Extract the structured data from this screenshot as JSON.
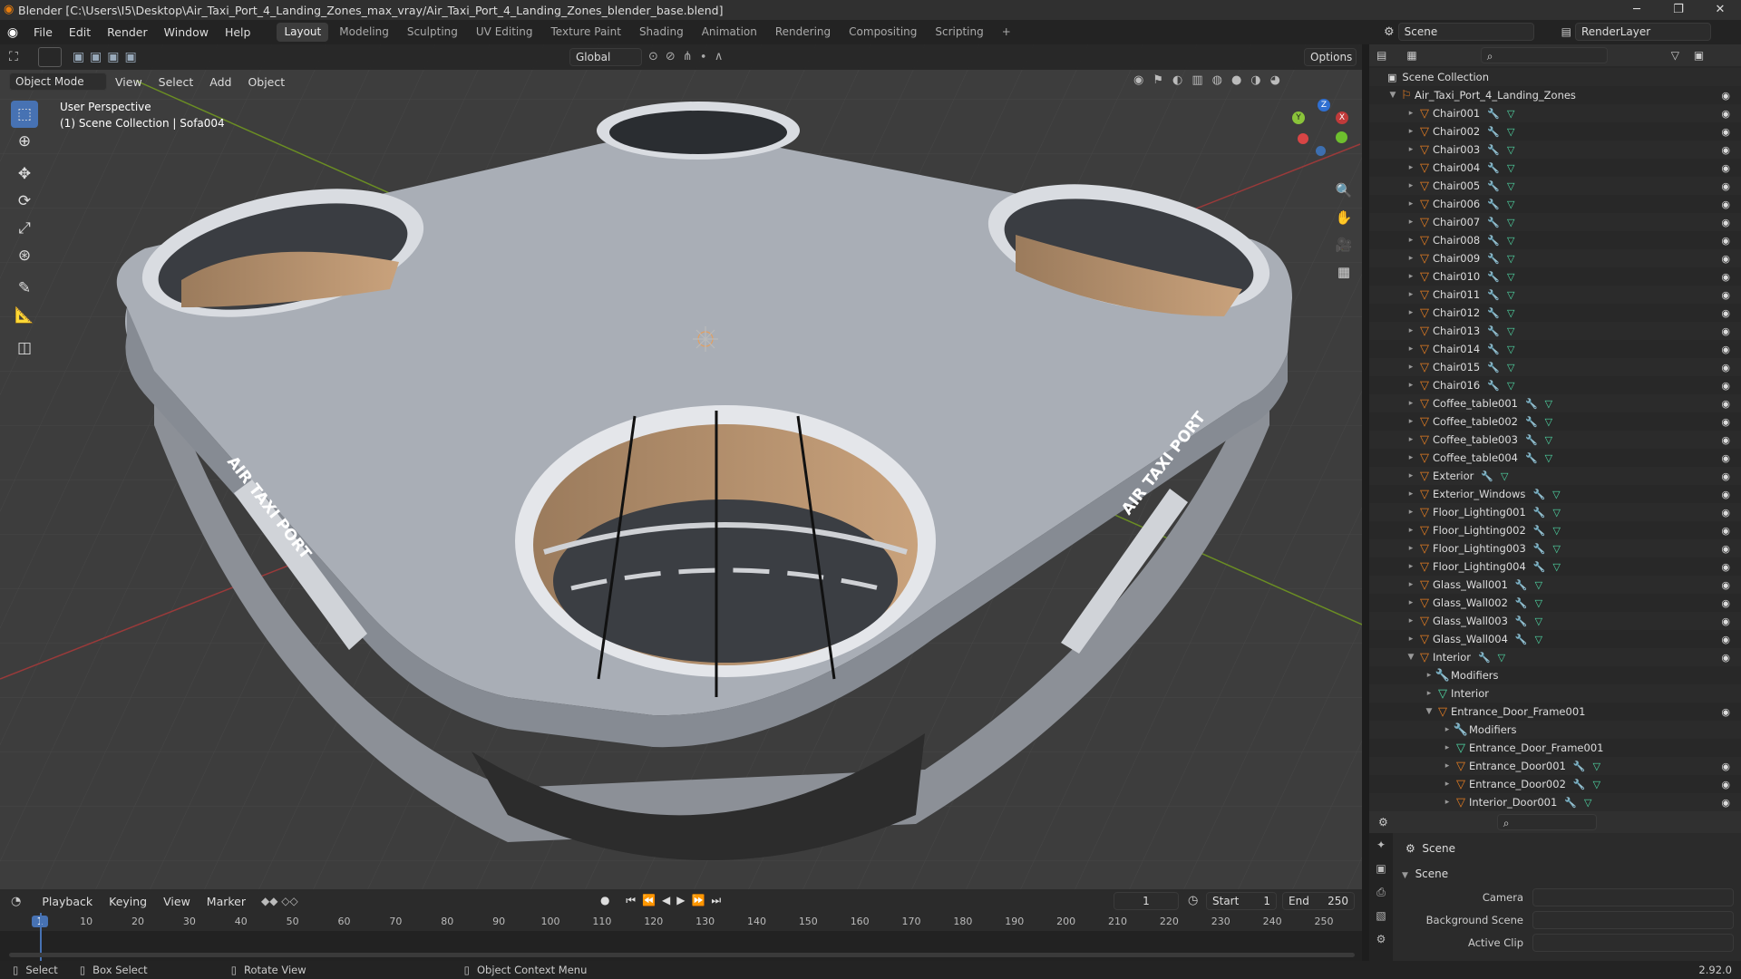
{
  "window": {
    "title": "Blender [C:\\Users\\I5\\Desktop\\Air_Taxi_Port_4_Landing_Zones_max_vray/Air_Taxi_Port_4_Landing_Zones_blender_base.blend]"
  },
  "menubar": {
    "items": [
      "File",
      "Edit",
      "Render",
      "Window",
      "Help"
    ]
  },
  "workspaces": {
    "tabs": [
      "Layout",
      "Modeling",
      "Sculpting",
      "UV Editing",
      "Texture Paint",
      "Shading",
      "Animation",
      "Rendering",
      "Compositing",
      "Scripting"
    ],
    "active": "Layout",
    "add": "+"
  },
  "scene": {
    "label": "Scene",
    "renderlayer": "RenderLayer"
  },
  "viewport": {
    "orientation": "Global",
    "options": "Options",
    "mode": "Object Mode",
    "menus": [
      "View",
      "Select",
      "Add",
      "Object"
    ],
    "info_line1": "User Perspective",
    "info_line2": "(1) Scene Collection | Sofa004",
    "sign_left": "AIR TAXI PORT",
    "sign_right": "AIR TAXI PORT",
    "gizmo": {
      "x": "X",
      "y": "Y",
      "z": "Z"
    }
  },
  "outliner": {
    "root": "Scene Collection",
    "collection": "Air_Taxi_Port_4_Landing_Zones",
    "items": [
      "Chair001",
      "Chair002",
      "Chair003",
      "Chair004",
      "Chair005",
      "Chair006",
      "Chair007",
      "Chair008",
      "Chair009",
      "Chair010",
      "Chair011",
      "Chair012",
      "Chair013",
      "Chair014",
      "Chair015",
      "Chair016",
      "Coffee_table001",
      "Coffee_table002",
      "Coffee_table003",
      "Coffee_table004",
      "Exterior",
      "Exterior_Windows",
      "Floor_Lighting001",
      "Floor_Lighting002",
      "Floor_Lighting003",
      "Floor_Lighting004",
      "Glass_Wall001",
      "Glass_Wall002",
      "Glass_Wall003",
      "Glass_Wall004",
      "Interior"
    ],
    "children": [
      {
        "label": "Modifiers",
        "depth": 2
      },
      {
        "label": "Interior",
        "depth": 2
      },
      {
        "label": "Entrance_Door_Frame001",
        "depth": 2
      },
      {
        "label": "Modifiers",
        "depth": 3
      },
      {
        "label": "Entrance_Door_Frame001",
        "depth": 3
      },
      {
        "label": "Entrance_Door001",
        "depth": 3
      },
      {
        "label": "Entrance_Door002",
        "depth": 3
      },
      {
        "label": "Interior_Door001",
        "depth": 3
      }
    ]
  },
  "properties": {
    "header": "Scene",
    "section": "Scene",
    "camera_label": "Camera",
    "bg_label": "Background Scene",
    "clip_label": "Active Clip"
  },
  "timeline": {
    "menus": [
      "Playback",
      "Keying",
      "View",
      "Marker"
    ],
    "current_frame": "1",
    "start_label": "Start",
    "start": "1",
    "end_label": "End",
    "end": "250",
    "ticks": [
      "1",
      "10",
      "20",
      "30",
      "40",
      "50",
      "60",
      "70",
      "80",
      "90",
      "100",
      "110",
      "120",
      "130",
      "140",
      "150",
      "160",
      "170",
      "180",
      "190",
      "200",
      "210",
      "220",
      "230",
      "240",
      "250"
    ]
  },
  "statusbar": {
    "select": "Select",
    "box_select": "Box Select",
    "rotate": "Rotate View",
    "context": "Object Context Menu",
    "version": "2.92.0"
  }
}
